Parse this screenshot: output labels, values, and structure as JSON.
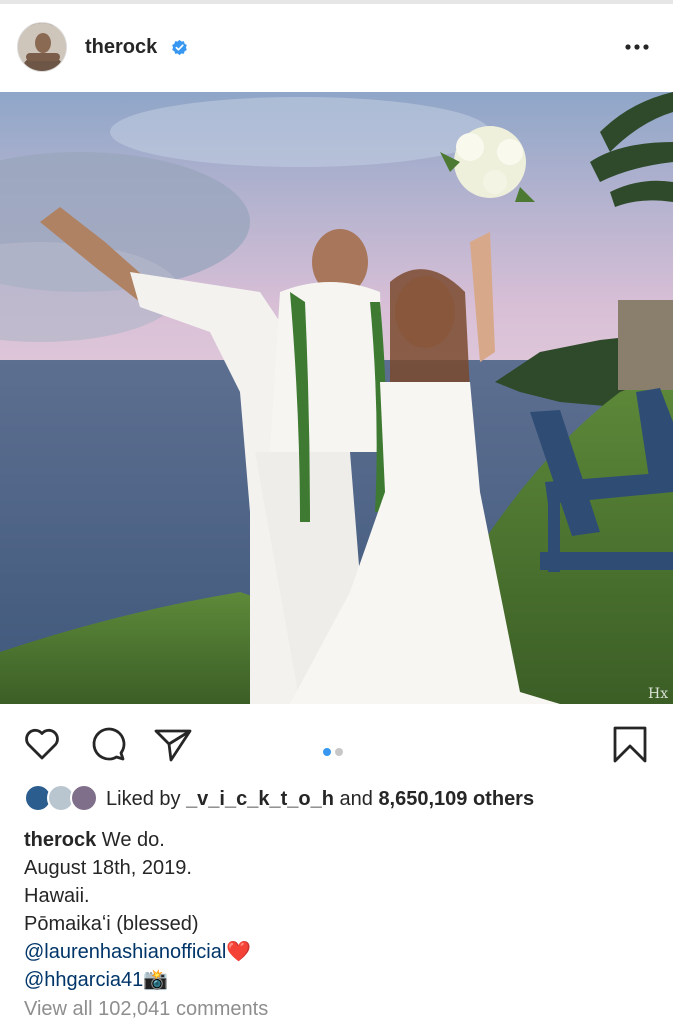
{
  "post": {
    "username": "therock",
    "verified": true,
    "photo_alt": "",
    "carousel": {
      "count": 2,
      "active": 1
    }
  },
  "actions": {
    "like_icon": "heart-icon",
    "comment_icon": "comment-icon",
    "share_icon": "paper-plane-icon",
    "save_icon": "bookmark-icon"
  },
  "likes": {
    "prefix": "Liked by ",
    "liked_by_user": "_v_i_c_k_t_o_h",
    "connector": " and ",
    "others": "8,650,109 others"
  },
  "caption": {
    "username": "therock",
    "line1": " We do.",
    "line2": "August 18th, 2019.",
    "line3": "Hawaii.",
    "line4": "Pōmaikaʻi (blessed)",
    "mention1": "@laurenhashianofficial",
    "mention1_emoji": "❤️",
    "mention2": "@hhgarcia41",
    "mention2_emoji": "📸"
  },
  "comments": {
    "view_all": "View all 102,041 comments"
  },
  "colors": {
    "accent": "#3897f0",
    "mention": "#003569",
    "muted": "#8e8e8e"
  }
}
